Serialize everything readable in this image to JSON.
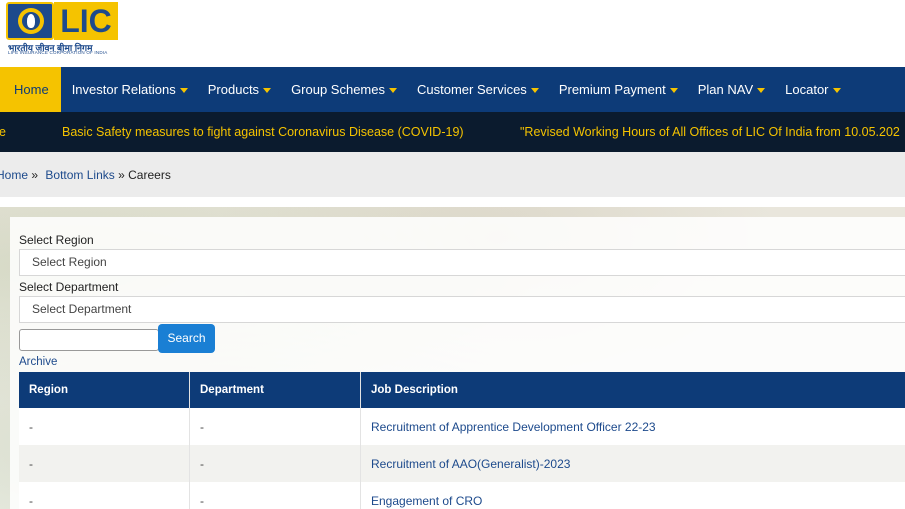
{
  "logo": {
    "text": "LIC",
    "hindi": "भारतीय जीवन बीमा निगम",
    "english": "LIFE INSURANCE CORPORATION OF INDIA"
  },
  "nav": {
    "items": [
      {
        "label": "Home",
        "active": true,
        "dropdown": false
      },
      {
        "label": "Investor Relations",
        "dropdown": true
      },
      {
        "label": "Products",
        "dropdown": true
      },
      {
        "label": "Group Schemes",
        "dropdown": true
      },
      {
        "label": "Customer Services",
        "dropdown": true
      },
      {
        "label": "Premium Payment",
        "dropdown": true
      },
      {
        "label": "Plan NAV",
        "dropdown": true
      },
      {
        "label": "Locator",
        "dropdown": true
      }
    ]
  },
  "ticker": {
    "fragment": "e",
    "item1": "Basic Safety measures to fight against Coronavirus Disease (COVID-19)",
    "item2": "\"Revised Working Hours of All Offices of LIC Of India from 10.05.202"
  },
  "breadcrumb": {
    "home": "Home",
    "sep1": "»",
    "bottom_links": "Bottom Links",
    "sep2": "»",
    "current": "Careers"
  },
  "form": {
    "region_label": "Select Region",
    "region_value": "Select Region",
    "department_label": "Select Department",
    "department_value": "Select Department",
    "search_button": "Search",
    "archive_link": "Archive"
  },
  "table": {
    "headers": [
      "Region",
      "Department",
      "Job Description"
    ],
    "rows": [
      {
        "region": "-",
        "department": "-",
        "job": "Recruitment of Apprentice Development Officer 22-23"
      },
      {
        "region": "-",
        "department": "-",
        "job": "Recruitment of AAO(Generalist)-2023"
      },
      {
        "region": "-",
        "department": "-",
        "job": "Engagement of CRO"
      }
    ]
  },
  "colors": {
    "nav_bg": "#0d3b78",
    "accent_yellow": "#f5c300",
    "ticker_bg": "#0b1b2e",
    "search_button": "#1a7fd4"
  }
}
